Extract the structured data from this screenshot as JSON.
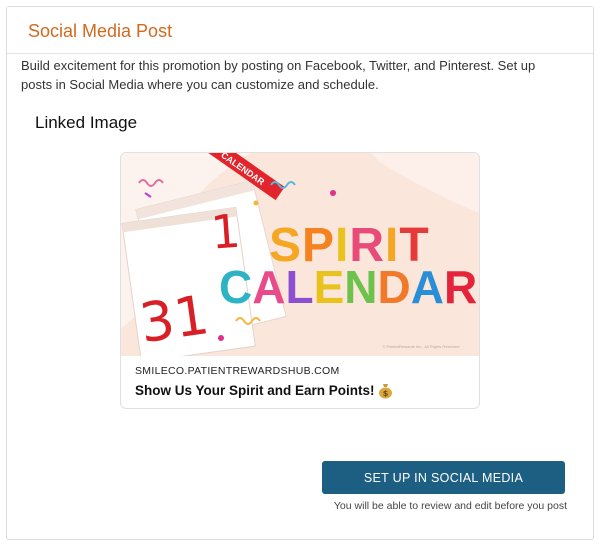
{
  "card": {
    "title": "Social Media Post",
    "description": "Build excitement for this promotion by posting on Facebook, Twitter, and Pinterest. Set up posts in Social Media where you can customize and schedule."
  },
  "linked_image": {
    "heading": "Linked Image",
    "image_text": {
      "line1": "SPIRIT",
      "line2": "CALENDAR",
      "page_number_left": "31",
      "page_number_right": "1",
      "tab_text": "CALENDAR",
      "copyright": "© PatientRewards Inc., All Rights Reserved"
    },
    "domain": "SMILECO.PATIENTREWARDSHUB.COM",
    "post_title": "Show Us Your Spirit and Earn Points!",
    "post_title_icon": "money-bag-icon"
  },
  "actions": {
    "setup_button": "SET UP IN SOCIAL MEDIA",
    "note": "You will be able to review and edit before you post"
  },
  "colors": {
    "title_orange": "#d2691e",
    "button_blue": "#1d5f82",
    "image_bg": "#fbe6dc"
  }
}
